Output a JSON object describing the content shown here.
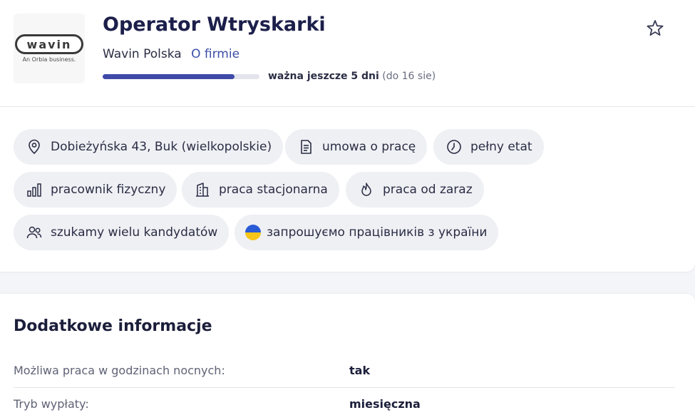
{
  "header": {
    "job_title": "Operator Wtryskarki",
    "company_name": "Wavin Polska",
    "about_link": "O firmie",
    "logo_text": "wavin",
    "logo_subtext": "An Orbia business.",
    "validity_main": "ważna jeszcze 5 dni",
    "validity_date": "(do 16 sie)",
    "validity_progress_fraction": 0.84,
    "favorite_icon": "star-outline-icon"
  },
  "chips": [
    {
      "label": "Dobieżyńska 43, Buk (wielkopolskie)",
      "icon": "location-pin-icon"
    },
    {
      "label": "umowa o pracę",
      "icon": "document-icon"
    },
    {
      "label": "pełny etat",
      "icon": "clock-icon"
    },
    {
      "label": "pracownik fizyczny",
      "icon": "bar-chart-icon"
    },
    {
      "label": "praca stacjonarna",
      "icon": "building-icon"
    },
    {
      "label": "praca od zaraz",
      "icon": "flame-icon"
    },
    {
      "label": "szukamy wielu kandydatów",
      "icon": "users-icon"
    },
    {
      "label": "запрошуємо працівників з україни",
      "icon": "ukraine-flag-icon"
    }
  ],
  "additional_info": {
    "title": "Dodatkowe informacje",
    "rows": [
      {
        "label": "Możliwa praca w godzinach nocnych:",
        "value": "tak"
      },
      {
        "label": "Tryb wypłaty:",
        "value": "miesięczna"
      }
    ]
  },
  "colors": {
    "accent": "#3b4ea8",
    "progress": "#3f4aa8",
    "chip_bg": "#eff0f4",
    "flag_blue": "#2a5bd7",
    "flag_yellow": "#f5c518"
  }
}
